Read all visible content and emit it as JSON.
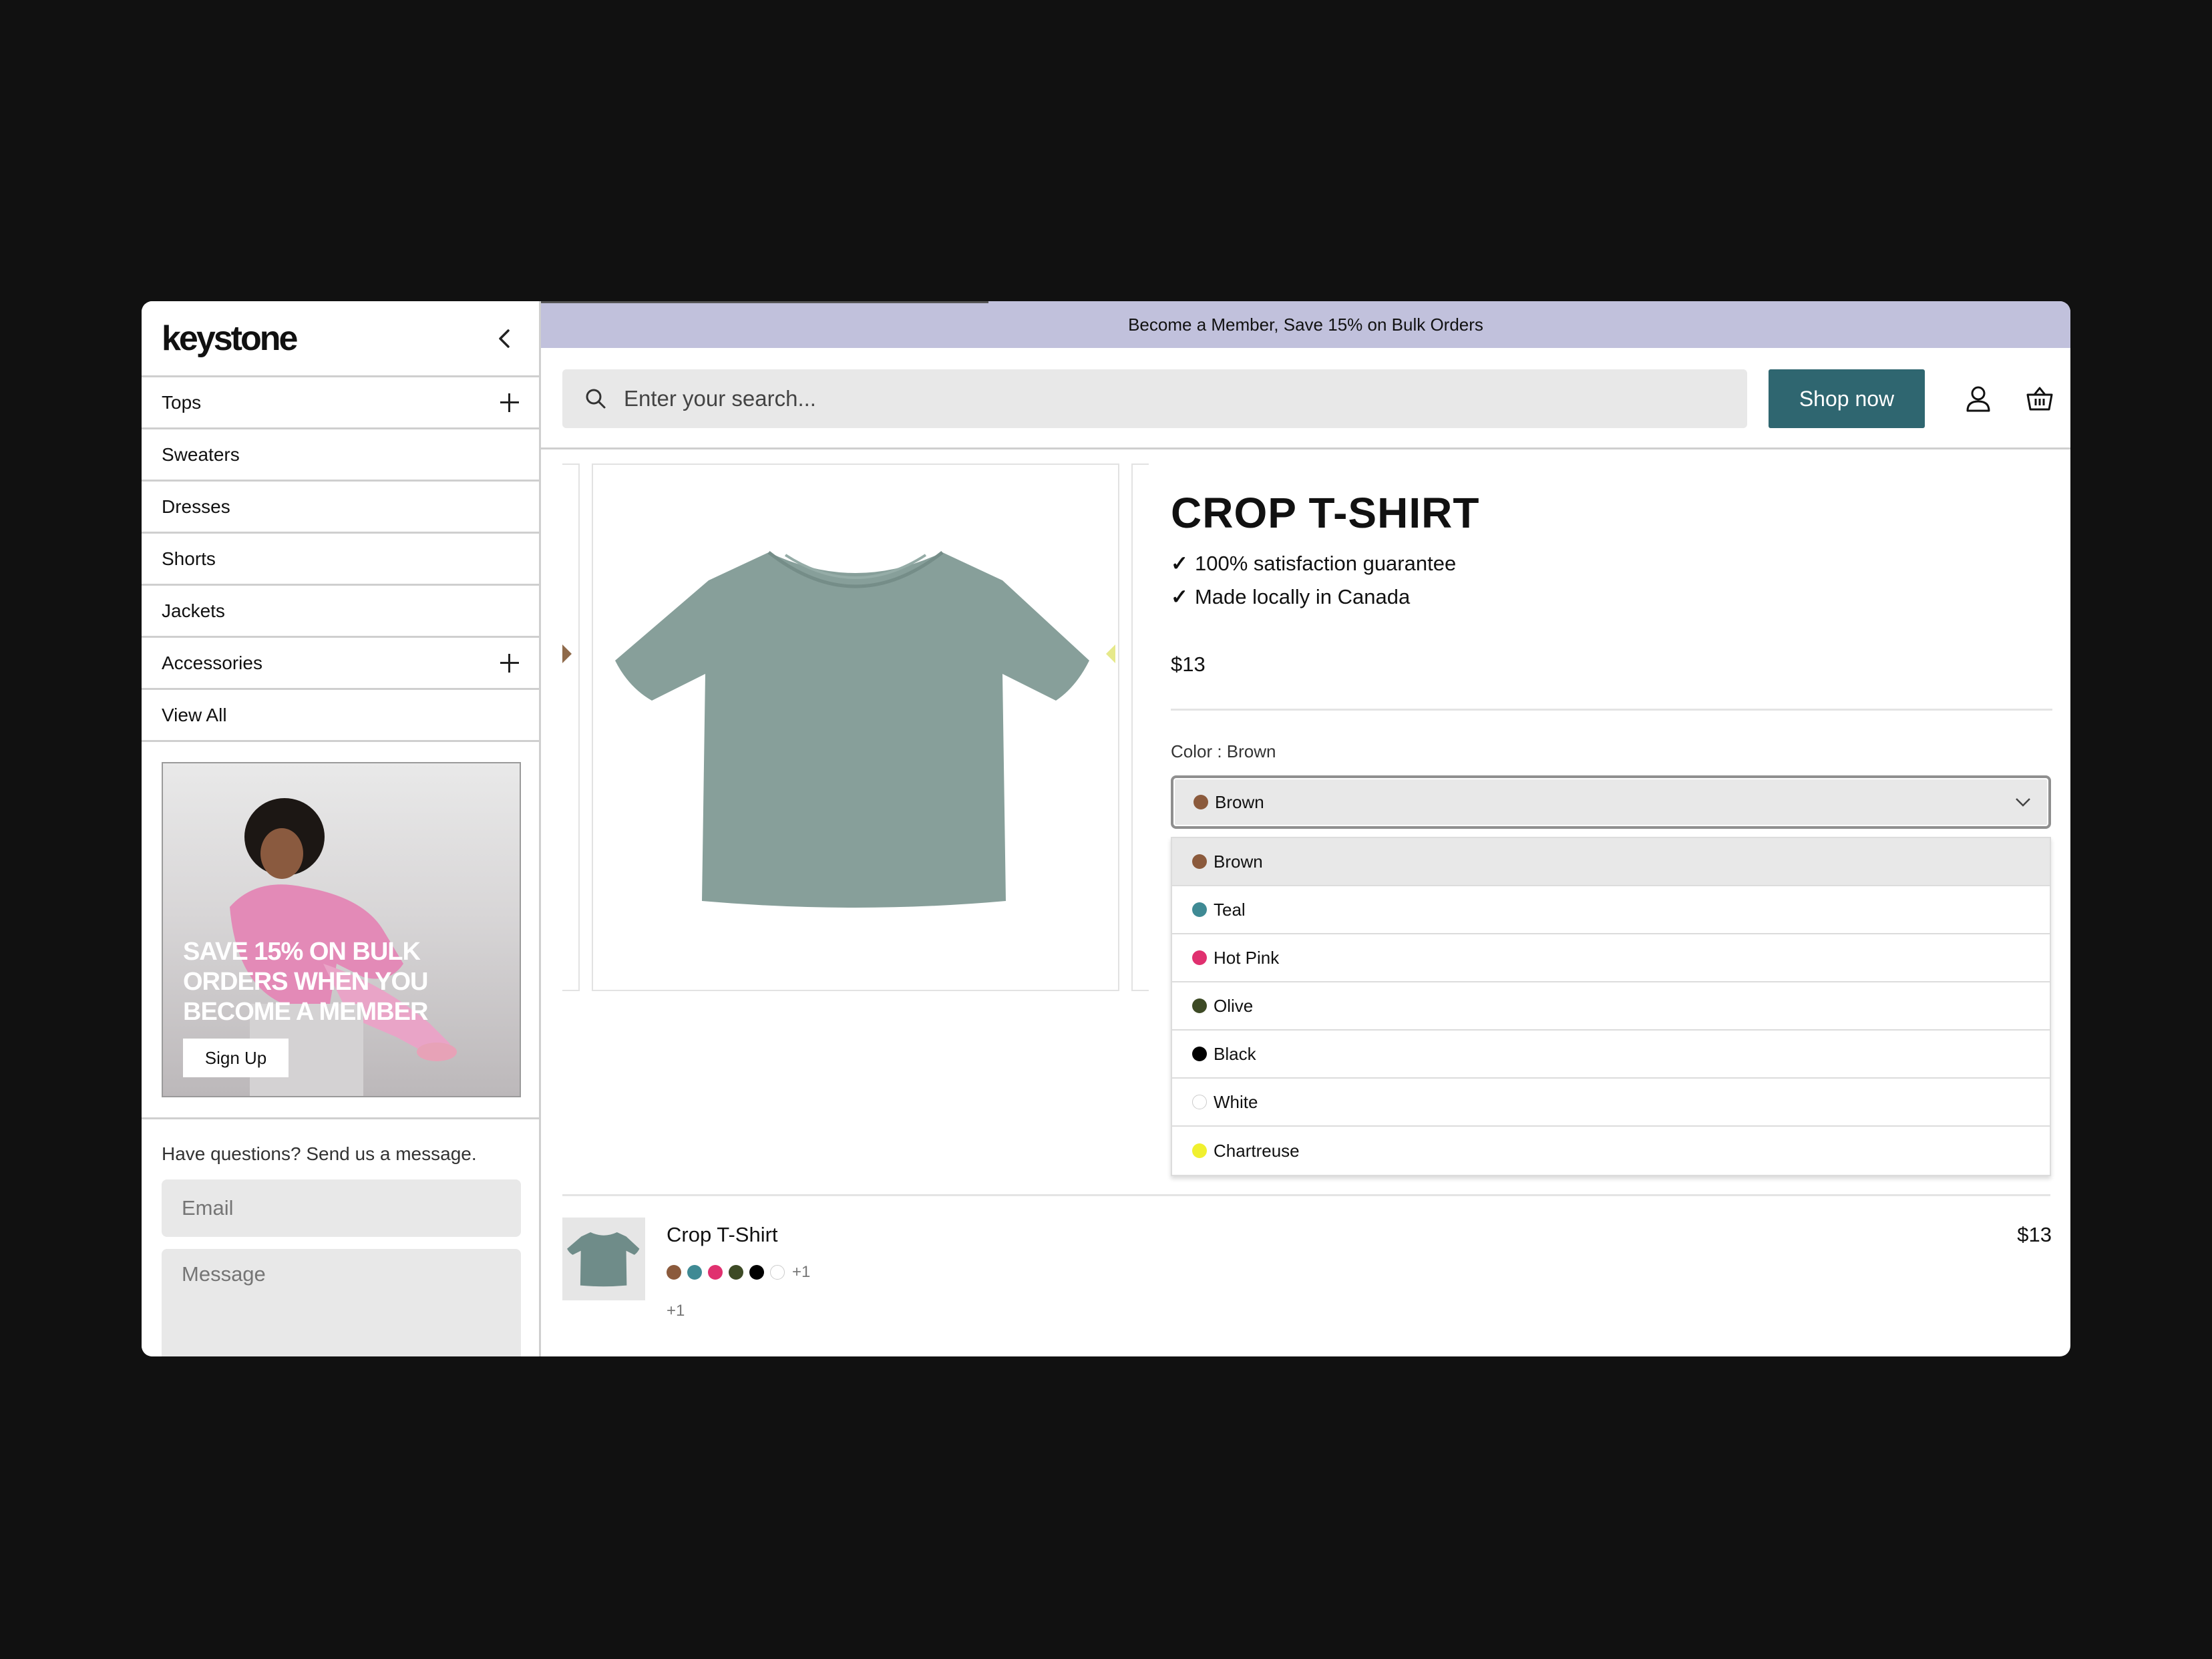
{
  "sidebar": {
    "logo": "keystone",
    "nav": [
      {
        "label": "Tops",
        "expandable": true
      },
      {
        "label": "Sweaters",
        "expandable": false
      },
      {
        "label": "Dresses",
        "expandable": false
      },
      {
        "label": "Shorts",
        "expandable": false
      },
      {
        "label": "Jackets",
        "expandable": false
      },
      {
        "label": "Accessories",
        "expandable": true
      },
      {
        "label": "View All",
        "expandable": false
      }
    ],
    "promo": {
      "headline": "SAVE 15% ON BULK ORDERS WHEN YOU BECOME A MEMBER",
      "button": "Sign Up"
    },
    "contact": {
      "label": "Have questions? Send us a message.",
      "email_placeholder": "Email",
      "message_placeholder": "Message"
    }
  },
  "announcement": "Become a Member, Save 15% on Bulk Orders",
  "header": {
    "search_placeholder": "Enter your search...",
    "shop_button": "Shop now",
    "account_icon": "user-icon",
    "cart_icon": "basket-icon",
    "accent": "#2f6670"
  },
  "product": {
    "title": "CROP T-SHIRT",
    "features": [
      "100% satisfaction guarantee",
      "Made locally in Canada"
    ],
    "price": "$13",
    "color_label": "Color : Brown",
    "selected_color": "Brown",
    "colors": [
      {
        "name": "Brown",
        "hex": "#8b5a3c"
      },
      {
        "name": "Teal",
        "hex": "#3f8a94"
      },
      {
        "name": "Hot Pink",
        "hex": "#e0306f"
      },
      {
        "name": "Olive",
        "hex": "#3d4a25"
      },
      {
        "name": "Black",
        "hex": "#000000"
      },
      {
        "name": "White",
        "hex": "#ffffff"
      },
      {
        "name": "Chartreuse",
        "hex": "#f0f02f"
      }
    ]
  },
  "cart_row": {
    "name": "Crop T-Shirt",
    "price": "$13",
    "swatch_more": "+1",
    "more": "+1"
  }
}
